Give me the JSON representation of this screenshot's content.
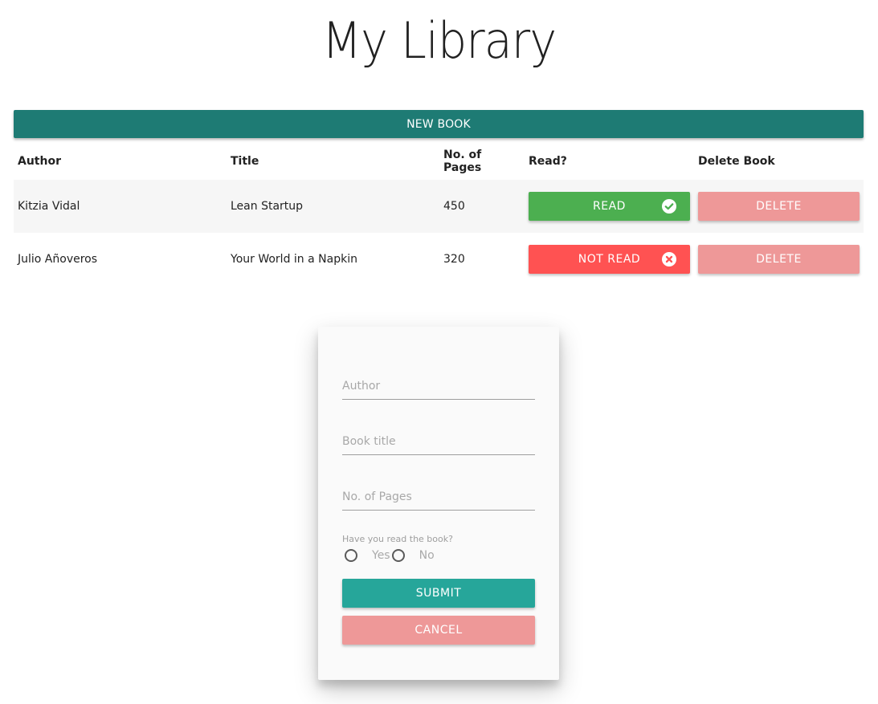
{
  "header": {
    "title": "My Library"
  },
  "toolbar": {
    "new_book_label": "NEW BOOK"
  },
  "table": {
    "columns": [
      "Author",
      "Title",
      "No. of Pages",
      "Read?",
      "Delete Book"
    ],
    "rows": [
      {
        "author": "Kitzia Vidal",
        "title": "Lean Startup",
        "pages": "450",
        "read_label": "READ",
        "read_status": "read",
        "read_icon": "check-circle-icon",
        "delete_label": "DELETE"
      },
      {
        "author": "Julio Añoveros",
        "title": "Your World in a Napkin",
        "pages": "320",
        "read_label": "NOT READ",
        "read_status": "not-read",
        "read_icon": "x-circle-icon",
        "delete_label": "DELETE"
      }
    ]
  },
  "form": {
    "author": {
      "placeholder": "Author",
      "value": ""
    },
    "title": {
      "placeholder": "Book title",
      "value": ""
    },
    "pages": {
      "placeholder": "No. of Pages",
      "value": ""
    },
    "read_question": "Have you read the book?",
    "read_options": [
      "Yes",
      "No"
    ],
    "submit_label": "SUBMIT",
    "cancel_label": "CANCEL"
  },
  "colors": {
    "primary": "#1e7b74",
    "submit": "#26a69a",
    "read": "#4caf50",
    "not_read": "#ff5252",
    "delete": "#ee9898"
  }
}
